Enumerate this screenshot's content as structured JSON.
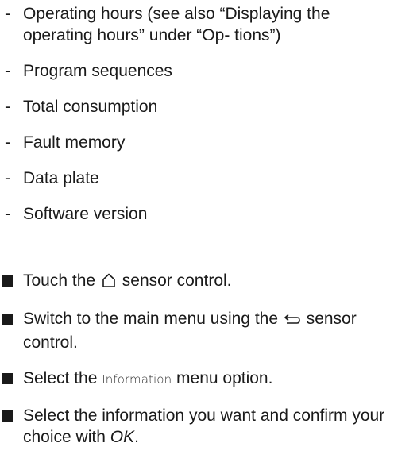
{
  "info_items": [
    "Operating hours (see also “Displaying the operating hours” under “Op- tions”)",
    "Program sequences",
    "Total consumption",
    "Fault memory",
    "Data plate",
    "Software version"
  ],
  "steps": {
    "touch_pre": "Touch the",
    "touch_icon": "house-outline",
    "touch_post": "sensor control.",
    "switch_pre": "Switch to the main menu using the",
    "switch_icon": "back-arrow",
    "switch_post": "sensor control.",
    "select_pre": "Select the",
    "select_menu": "Information",
    "select_post": "menu option.",
    "confirm_pre": "Select the information you want and confirm your choice with",
    "confirm_ok": "OK",
    "confirm_post": "."
  }
}
